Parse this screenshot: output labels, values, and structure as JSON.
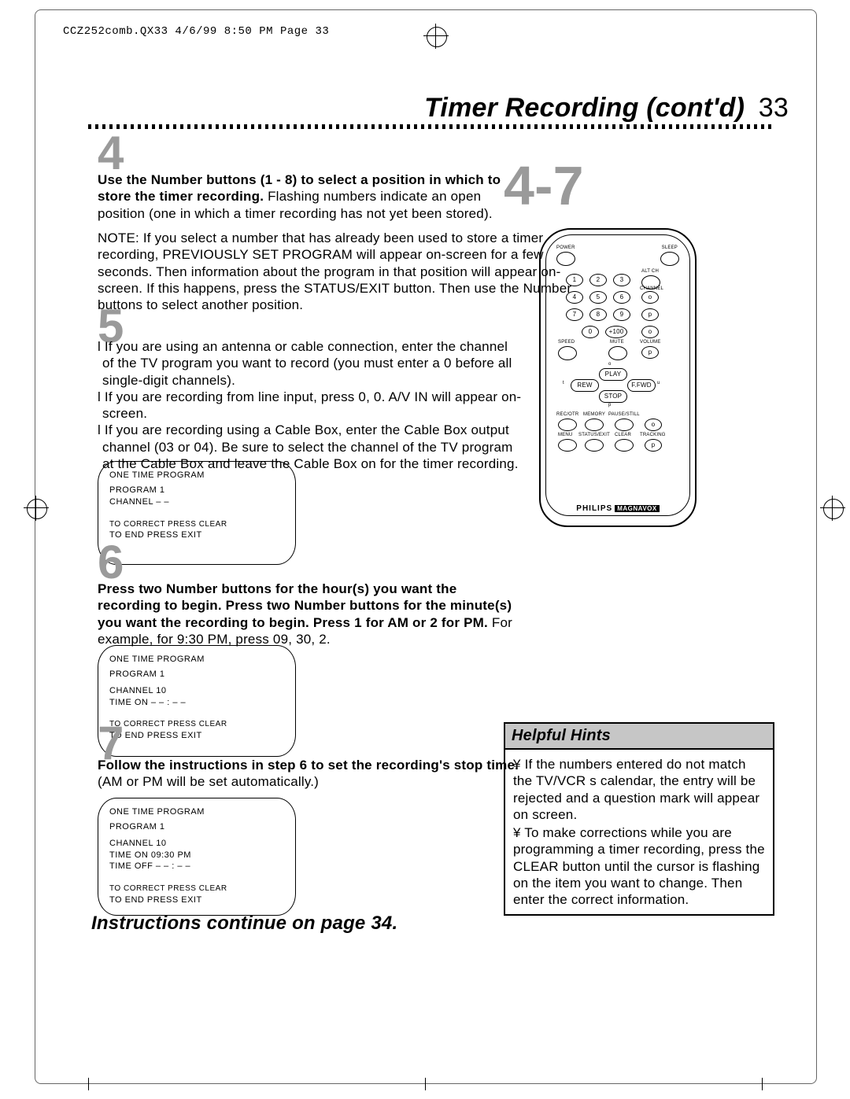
{
  "header": {
    "slug": "CCZ252comb.QX33  4/6/99 8:50 PM  Page 33"
  },
  "title": {
    "section": "Timer Recording (cont'd)",
    "page": "33"
  },
  "callout_steps": "4-7",
  "steps": {
    "4": {
      "num": "4",
      "bold": "Use the Number buttons (1 - 8) to select a position in which to store the timer recording.",
      "rest": " Flashing numbers indicate an open position (one in which a timer recording has not yet been stored).",
      "note": "NOTE: If you select a number that has already been used to store a timer recording, PREVIOUSLY SET PROGRAM will appear on-screen for a few seconds.  Then information about the program in that position will appear on-screen. If this happens, press the STATUS/EXIT button. Then use the Number buttons to select another position."
    },
    "5": {
      "num": "5",
      "b1": "If you are using an antenna or cable connection, enter the channel of the TV program you want to record (you must enter a 0 before all single-digit channels).",
      "b2": "If you are recording from line input, press 0, 0.  A/V IN will appear on-screen.",
      "b3": "If you are recording using a Cable Box, enter the Cable Box output channel (03 or 04). Be sure to select the channel of the TV program at the Cable Box and leave the Cable Box on for the timer recording."
    },
    "6": {
      "num": "6",
      "bold": "Press two Number buttons for the hour(s) you want the recording to begin. Press two Number buttons for the minute(s) you want the recording to begin. Press 1 for AM or 2 for PM.",
      "rest": " For example, for 9:30 PM, press 09, 30, 2."
    },
    "7": {
      "num": "7",
      "bold": "Follow the instructions in step 6 to set the recording's stop time.",
      "rest": " (AM or PM will be set automatically.)"
    }
  },
  "osd1": {
    "title": "ONE TIME PROGRAM",
    "program": "PROGRAM   1",
    "channel": "CHANNEL   – –",
    "f1": "TO CORRECT PRESS CLEAR",
    "f2": "TO END PRESS EXIT"
  },
  "osd2": {
    "title": "ONE TIME PROGRAM",
    "program": "PROGRAM   1",
    "channel": "CHANNEL   10",
    "timeon": "TIME ON    – – : – –",
    "f1": "TO CORRECT PRESS CLEAR",
    "f2": "TO END PRESS EXIT"
  },
  "osd3": {
    "title": "ONE TIME PROGRAM",
    "program": "PROGRAM   1",
    "channel": "CHANNEL   10",
    "timeon": "TIME ON    09:30  PM",
    "timeoff": "TIME OFF   – – : – –",
    "f1": "TO CORRECT PRESS CLEAR",
    "f2": "TO END PRESS EXIT"
  },
  "hints": {
    "title": "Helpful Hints",
    "b1": "¥  If the numbers entered do not match the TV/VCR s calendar, the entry will be rejected and a question mark will appear on screen.",
    "b2": "¥  To make corrections while you are programming a timer recording, press the CLEAR button until the cursor is flashing on the item you want to change. Then enter the correct information."
  },
  "continue": "Instructions continue on page 34.",
  "remote": {
    "power": "POWER",
    "sleep": "SLEEP",
    "altch": "ALT CH",
    "channel": "CHANNEL",
    "speed": "SPEED",
    "mute": "MUTE",
    "volume": "VOLUME",
    "play": "PLAY",
    "rew": "REW",
    "ffwd": "F.FWD",
    "stop": "STOP",
    "recotr": "REC/OTR",
    "memory": "MEMORY",
    "pause": "PAUSE/STILL",
    "menu": "MENU",
    "status": "STATUS/EXIT",
    "clear": "CLEAR",
    "tracking": "TRACKING",
    "n0": "0",
    "n1": "1",
    "n2": "2",
    "n3": "3",
    "n4": "4",
    "n5": "5",
    "n6": "6",
    "n7": "7",
    "n8": "8",
    "n9": "9",
    "n100": "+100",
    "o_up": "o",
    "o_dn": "p",
    "tri_l": "t",
    "tri_r": "u",
    "brand": "PHILIPS",
    "brand2": "MAGNAVOX"
  }
}
